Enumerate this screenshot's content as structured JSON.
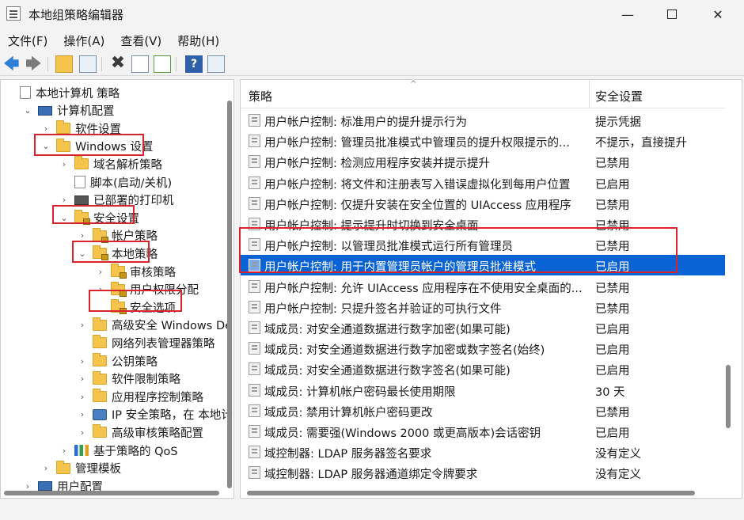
{
  "window": {
    "title": "本地组策略编辑器",
    "min": "—",
    "close": "✕"
  },
  "menu": [
    "文件(F)",
    "操作(A)",
    "查看(V)",
    "帮助(H)"
  ],
  "toolbar": {
    "back": "🡄",
    "forward": "🡆",
    "delete": "✖",
    "help": "?"
  },
  "tree": [
    {
      "label": "本地计算机 策略",
      "icon": "policy-icon",
      "twisty": "",
      "indent": 0
    },
    {
      "label": "计算机配置",
      "icon": "computer-icon",
      "twisty": "⌄",
      "indent": 1
    },
    {
      "label": "软件设置",
      "icon": "folder-icon",
      "twisty": "›",
      "indent": 2
    },
    {
      "label": "Windows 设置",
      "icon": "folder-icon",
      "twisty": "⌄",
      "indent": 2
    },
    {
      "label": "域名解析策略",
      "icon": "folder-icon",
      "twisty": "›",
      "indent": 3
    },
    {
      "label": "脚本(启动/关机)",
      "icon": "script-icon",
      "twisty": "",
      "indent": 3
    },
    {
      "label": "已部署的打印机",
      "icon": "printer-icon",
      "twisty": "›",
      "indent": 3
    },
    {
      "label": "安全设置",
      "icon": "folder-lock-icon",
      "twisty": "⌄",
      "indent": 3
    },
    {
      "label": "帐户策略",
      "icon": "folder-lock-icon",
      "twisty": "›",
      "indent": 4
    },
    {
      "label": "本地策略",
      "icon": "folder-lock-icon",
      "twisty": "⌄",
      "indent": 4
    },
    {
      "label": "审核策略",
      "icon": "folder-lock-icon",
      "twisty": "›",
      "indent": 5
    },
    {
      "label": "用户权限分配",
      "icon": "folder-lock-icon",
      "twisty": "›",
      "indent": 5
    },
    {
      "label": "安全选项",
      "icon": "folder-lock-icon",
      "twisty": "",
      "indent": 5
    },
    {
      "label": "高级安全 Windows De",
      "icon": "folder-icon",
      "twisty": "›",
      "indent": 4
    },
    {
      "label": "网络列表管理器策略",
      "icon": "folder-icon",
      "twisty": "",
      "indent": 4
    },
    {
      "label": "公钥策略",
      "icon": "folder-icon",
      "twisty": "›",
      "indent": 4
    },
    {
      "label": "软件限制策略",
      "icon": "folder-icon",
      "twisty": "›",
      "indent": 4
    },
    {
      "label": "应用程序控制策略",
      "icon": "folder-icon",
      "twisty": "›",
      "indent": 4
    },
    {
      "label": "IP 安全策略，在 本地计",
      "icon": "network-icon",
      "twisty": "›",
      "indent": 4
    },
    {
      "label": "高级审核策略配置",
      "icon": "folder-icon",
      "twisty": "›",
      "indent": 4
    },
    {
      "label": "基于策略的 QoS",
      "icon": "chart-icon",
      "twisty": "›",
      "indent": 3
    },
    {
      "label": "管理模板",
      "icon": "folder-icon",
      "twisty": "›",
      "indent": 2
    },
    {
      "label": "用户配置",
      "icon": "user-icon",
      "twisty": "›",
      "indent": 1
    }
  ],
  "columns": {
    "policy": "策略",
    "setting": "安全设置",
    "sort": "^"
  },
  "policies": [
    {
      "name": "用户帐户控制: 标准用户的提升提示行为",
      "setting": "提示凭据"
    },
    {
      "name": "用户帐户控制: 管理员批准模式中管理员的提升权限提示的...",
      "setting": "不提示，直接提升"
    },
    {
      "name": "用户帐户控制: 检测应用程序安装并提示提升",
      "setting": "已禁用"
    },
    {
      "name": "用户帐户控制: 将文件和注册表写入错误虚拟化到每用户位置",
      "setting": "已启用"
    },
    {
      "name": "用户帐户控制: 仅提升安装在安全位置的 UIAccess 应用程序",
      "setting": "已禁用"
    },
    {
      "name": "用户帐户控制: 提示提升时切换到安全桌面",
      "setting": "已禁用"
    },
    {
      "name": "用户帐户控制: 以管理员批准模式运行所有管理员",
      "setting": "已禁用"
    },
    {
      "name": "用户帐户控制: 用于内置管理员帐户的管理员批准模式",
      "setting": "已启用"
    },
    {
      "name": "用户帐户控制: 允许 UIAccess 应用程序在不使用安全桌面的...",
      "setting": "已禁用"
    },
    {
      "name": "用户帐户控制: 只提升签名并验证的可执行文件",
      "setting": "已禁用"
    },
    {
      "name": "域成员: 对安全通道数据进行数字加密(如果可能)",
      "setting": "已启用"
    },
    {
      "name": "域成员: 对安全通道数据进行数字加密或数字签名(始终)",
      "setting": "已启用"
    },
    {
      "name": "域成员: 对安全通道数据进行数字签名(如果可能)",
      "setting": "已启用"
    },
    {
      "name": "域成员: 计算机帐户密码最长使用期限",
      "setting": "30 天"
    },
    {
      "name": "域成员: 禁用计算机帐户密码更改",
      "setting": "已禁用"
    },
    {
      "name": "域成员: 需要强(Windows 2000 或更高版本)会话密钥",
      "setting": "已启用"
    },
    {
      "name": "域控制器: LDAP 服务器签名要求",
      "setting": "没有定义"
    },
    {
      "name": "域控制器: LDAP 服务器通道绑定令牌要求",
      "setting": "没有定义"
    }
  ],
  "selected_index": 7,
  "colors": {
    "selection": "#0a63d4",
    "highlight_box": "#d9232e",
    "folder": "#f5c44d"
  }
}
